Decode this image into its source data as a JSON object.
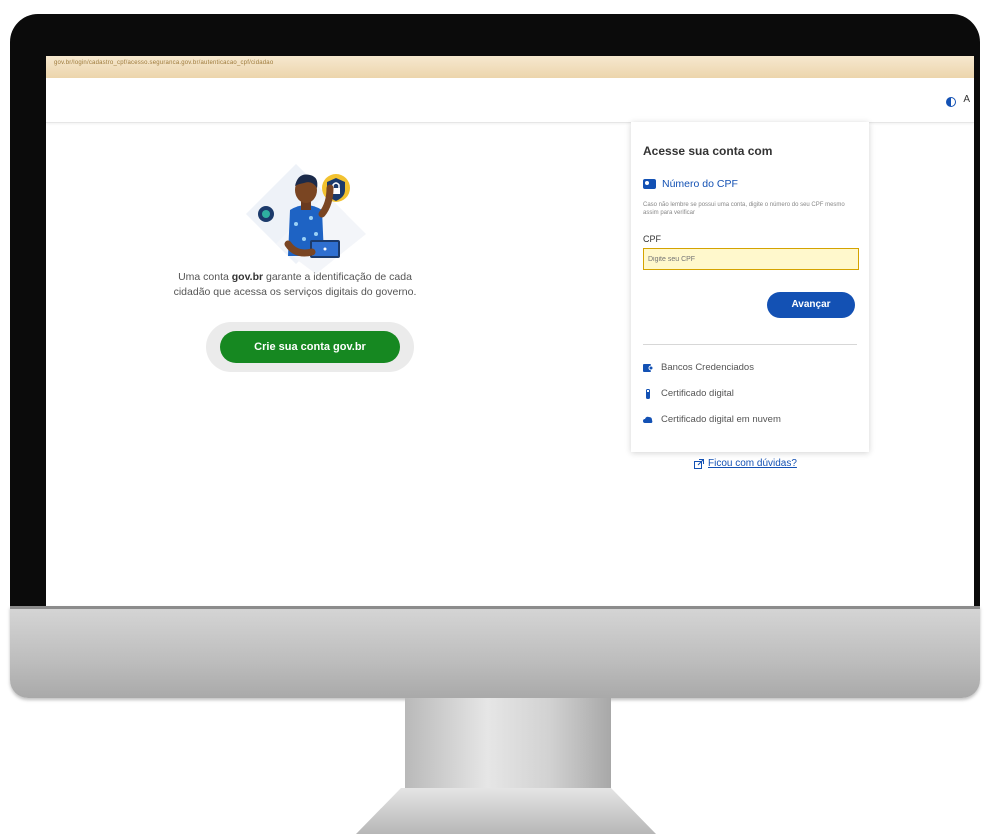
{
  "browser": {
    "url_text": "gov.br/login/cadastro_cpf/acesso.seguranca.gov.br/autenticacao_cpf/cidadao"
  },
  "header": {
    "contrast_label": "A"
  },
  "left": {
    "intro_prefix": "Uma conta ",
    "intro_brand": "gov.br",
    "intro_suffix": " garante a identificação de cada cidadão que acessa os serviços digitais do governo.",
    "create_button": "Crie sua conta gov.br"
  },
  "login": {
    "title": "Acesse sua conta com",
    "cpf_option": "Número do CPF",
    "hint": "Caso não lembre se possui uma conta, digite o número do seu CPF mesmo assim para verificar",
    "cpf_label": "CPF",
    "cpf_placeholder": "Digite seu CPF",
    "next_button": "Avançar",
    "alternatives": [
      {
        "label": "Bancos Credenciados",
        "icon": "bank-icon"
      },
      {
        "label": "Certificado digital",
        "icon": "usb-token-icon"
      },
      {
        "label": "Certificado digital em nuvem",
        "icon": "cloud-icon"
      }
    ]
  },
  "help_link": "Ficou com dúvidas?",
  "colors": {
    "gov_blue": "#1351b4",
    "gov_green": "#168821",
    "input_highlight": "#fff8cc"
  }
}
